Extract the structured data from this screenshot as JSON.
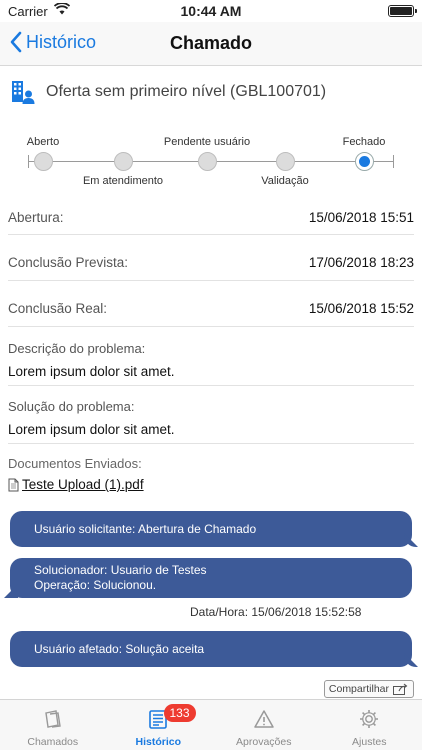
{
  "status_bar": {
    "carrier": "Carrier",
    "time": "10:44 AM"
  },
  "nav": {
    "back_label": "Histórico",
    "title": "Chamado"
  },
  "ticket": {
    "title": "Oferta sem primeiro nível (GBL100701)"
  },
  "stepper": {
    "steps": [
      {
        "label": "Aberto",
        "position": "top"
      },
      {
        "label": "Em atendimento",
        "position": "bottom"
      },
      {
        "label": "Pendente usuário",
        "position": "top"
      },
      {
        "label": "Validação",
        "position": "bottom"
      },
      {
        "label": "Fechado",
        "position": "top"
      }
    ],
    "active_step": "Fechado"
  },
  "details": {
    "abertura_label": "Abertura:",
    "abertura_value": "15/06/2018 15:51",
    "conclusao_prevista_label": "Conclusão Prevista:",
    "conclusao_prevista_value": "17/06/2018 18:23",
    "conclusao_real_label": "Conclusão Real:",
    "conclusao_real_value": "15/06/2018 15:52"
  },
  "descricao": {
    "label": "Descrição do problema:",
    "value": "Lorem ipsum dolor sit amet."
  },
  "solucao": {
    "label": "Solução do problema:",
    "value": "Lorem ipsum dolor sit amet."
  },
  "documentos": {
    "label": "Documentos Enviados:",
    "file_name": "Teste Upload (1).pdf"
  },
  "messages": {
    "m1": "Usuário solicitante: Abertura de Chamado",
    "m2_line1": "Solucionador: Usuario de Testes",
    "m2_line2": "Operação: Solucionou.",
    "datetime": "Data/Hora: 15/06/2018 15:52:58",
    "m3": "Usuário afetado: Solução aceita"
  },
  "share": {
    "label": "Compartilhar"
  },
  "tabs": [
    {
      "label": "Chamados"
    },
    {
      "label": "Histórico",
      "badge": "133"
    },
    {
      "label": "Aprovações"
    },
    {
      "label": "Ajustes"
    }
  ],
  "colors": {
    "accent": "#1a7ae0",
    "bubble": "#3d5a98",
    "badge": "#ee3b30"
  }
}
